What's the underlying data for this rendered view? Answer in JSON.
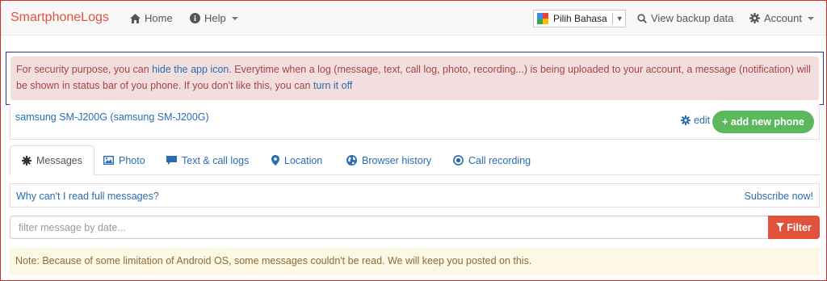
{
  "navbar": {
    "brand": "SmartphoneLogs",
    "home": "Home",
    "help": "Help",
    "language": "Pilih Bahasa",
    "view_backup": "View backup data",
    "account": "Account"
  },
  "alert": {
    "text_1": "For security purpose, you can ",
    "link_hide": "hide the app icon",
    "text_2": ". Everytime when a log (message, text, call log, photo, recording...) is being uploaded to your account, a message (notification) will be shown in status bar of you phone. If you don't like this, you can ",
    "link_turn_off": "turn it off"
  },
  "phone": {
    "name": "samsung SM-J200G (samsung SM-J200G)",
    "edit": "edit",
    "add_new": "+ add new phone"
  },
  "tabs": [
    {
      "label": "Messages",
      "icon": "gear-icon"
    },
    {
      "label": "Photo",
      "icon": "image-icon"
    },
    {
      "label": "Text & call logs",
      "icon": "comment-icon"
    },
    {
      "label": "Location",
      "icon": "map-marker-icon"
    },
    {
      "label": "Browser history",
      "icon": "globe-icon"
    },
    {
      "label": "Call recording",
      "icon": "record-icon"
    }
  ],
  "info": {
    "question": "Why can't I read full messages?",
    "subscribe": "Subscribe now!"
  },
  "filter": {
    "placeholder": "filter message by date...",
    "button": "Filter"
  },
  "note": "Note: Because of some limitation of Android OS, some messages couldn't be read. We will keep you posted on this.",
  "colors": {
    "brand": "#e1523d",
    "link": "#2a6db0",
    "alert_bg": "#f2dede",
    "success": "#5cb85c",
    "note_bg": "#fcf8e3"
  }
}
